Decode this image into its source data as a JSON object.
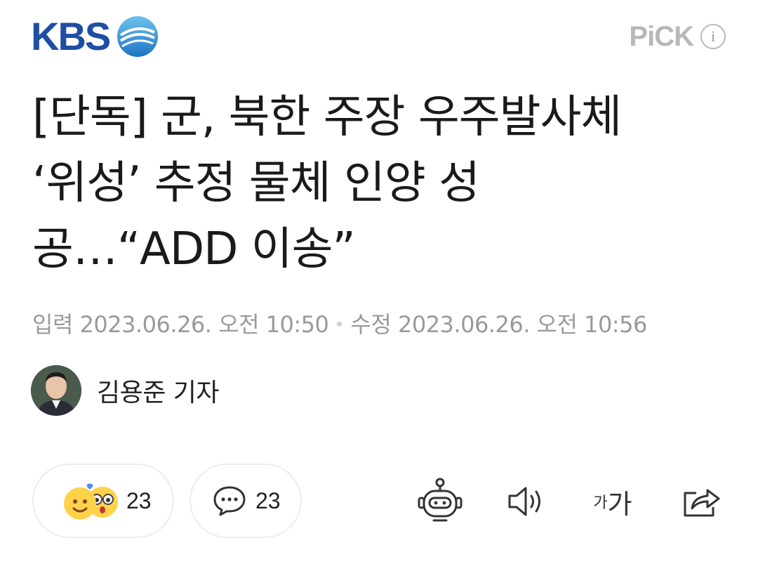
{
  "header": {
    "logo_text": "KBS",
    "pick_label": "PiCK",
    "info_symbol": "i"
  },
  "article": {
    "headline_line1": "[단독] 군, 북한 주장 우주발사체",
    "headline_line2": "‘위성’ 추정 물체 인양 성",
    "headline_line3": "공…“ADD 이송”",
    "input_label": "입력",
    "input_date": "2023.06.26. 오전 10:50",
    "modified_label": "수정",
    "modified_date": "2023.06.26. 오전 10:56",
    "author_name": "김용준 기자"
  },
  "actions": {
    "reaction_count": "23",
    "comment_count": "23",
    "font_small": "가",
    "font_big": "가"
  },
  "icons": {
    "reaction": "reaction-emoji-icon",
    "comment": "comment-bubble-icon",
    "summary_bot": "robot-summary-icon",
    "speaker": "speaker-icon",
    "share": "share-icon"
  },
  "colors": {
    "brand_blue": "#1f4ea3",
    "meta_gray": "#9a9a9a",
    "pick_gray": "#b8b8b8"
  }
}
